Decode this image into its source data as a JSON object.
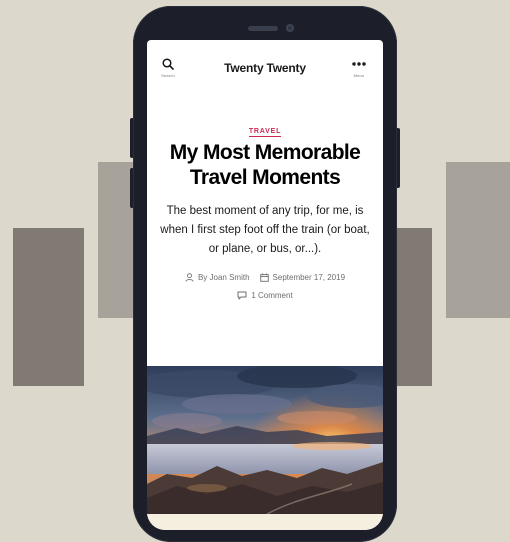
{
  "header": {
    "search_label": "Search",
    "site_title": "Twenty Twenty",
    "menu_label": "Menu"
  },
  "post": {
    "category": "TRAVEL",
    "title": "My Most Memorable Travel Moments",
    "excerpt": "The best moment of any trip, for me, is when I first step foot off the train (or boat, or plane, or bus, or...).",
    "author": "By Joan Smith",
    "date": "September 17, 2019",
    "comments": "1 Comment"
  },
  "colors": {
    "accent": "#cd2653",
    "background": "#ddd8cc",
    "phone_body": "#1c1f2a"
  },
  "icons": {
    "search": "search-icon",
    "menu": "more-dots-icon",
    "author": "person-icon",
    "date": "calendar-icon",
    "comments": "comment-bubble-icon"
  }
}
